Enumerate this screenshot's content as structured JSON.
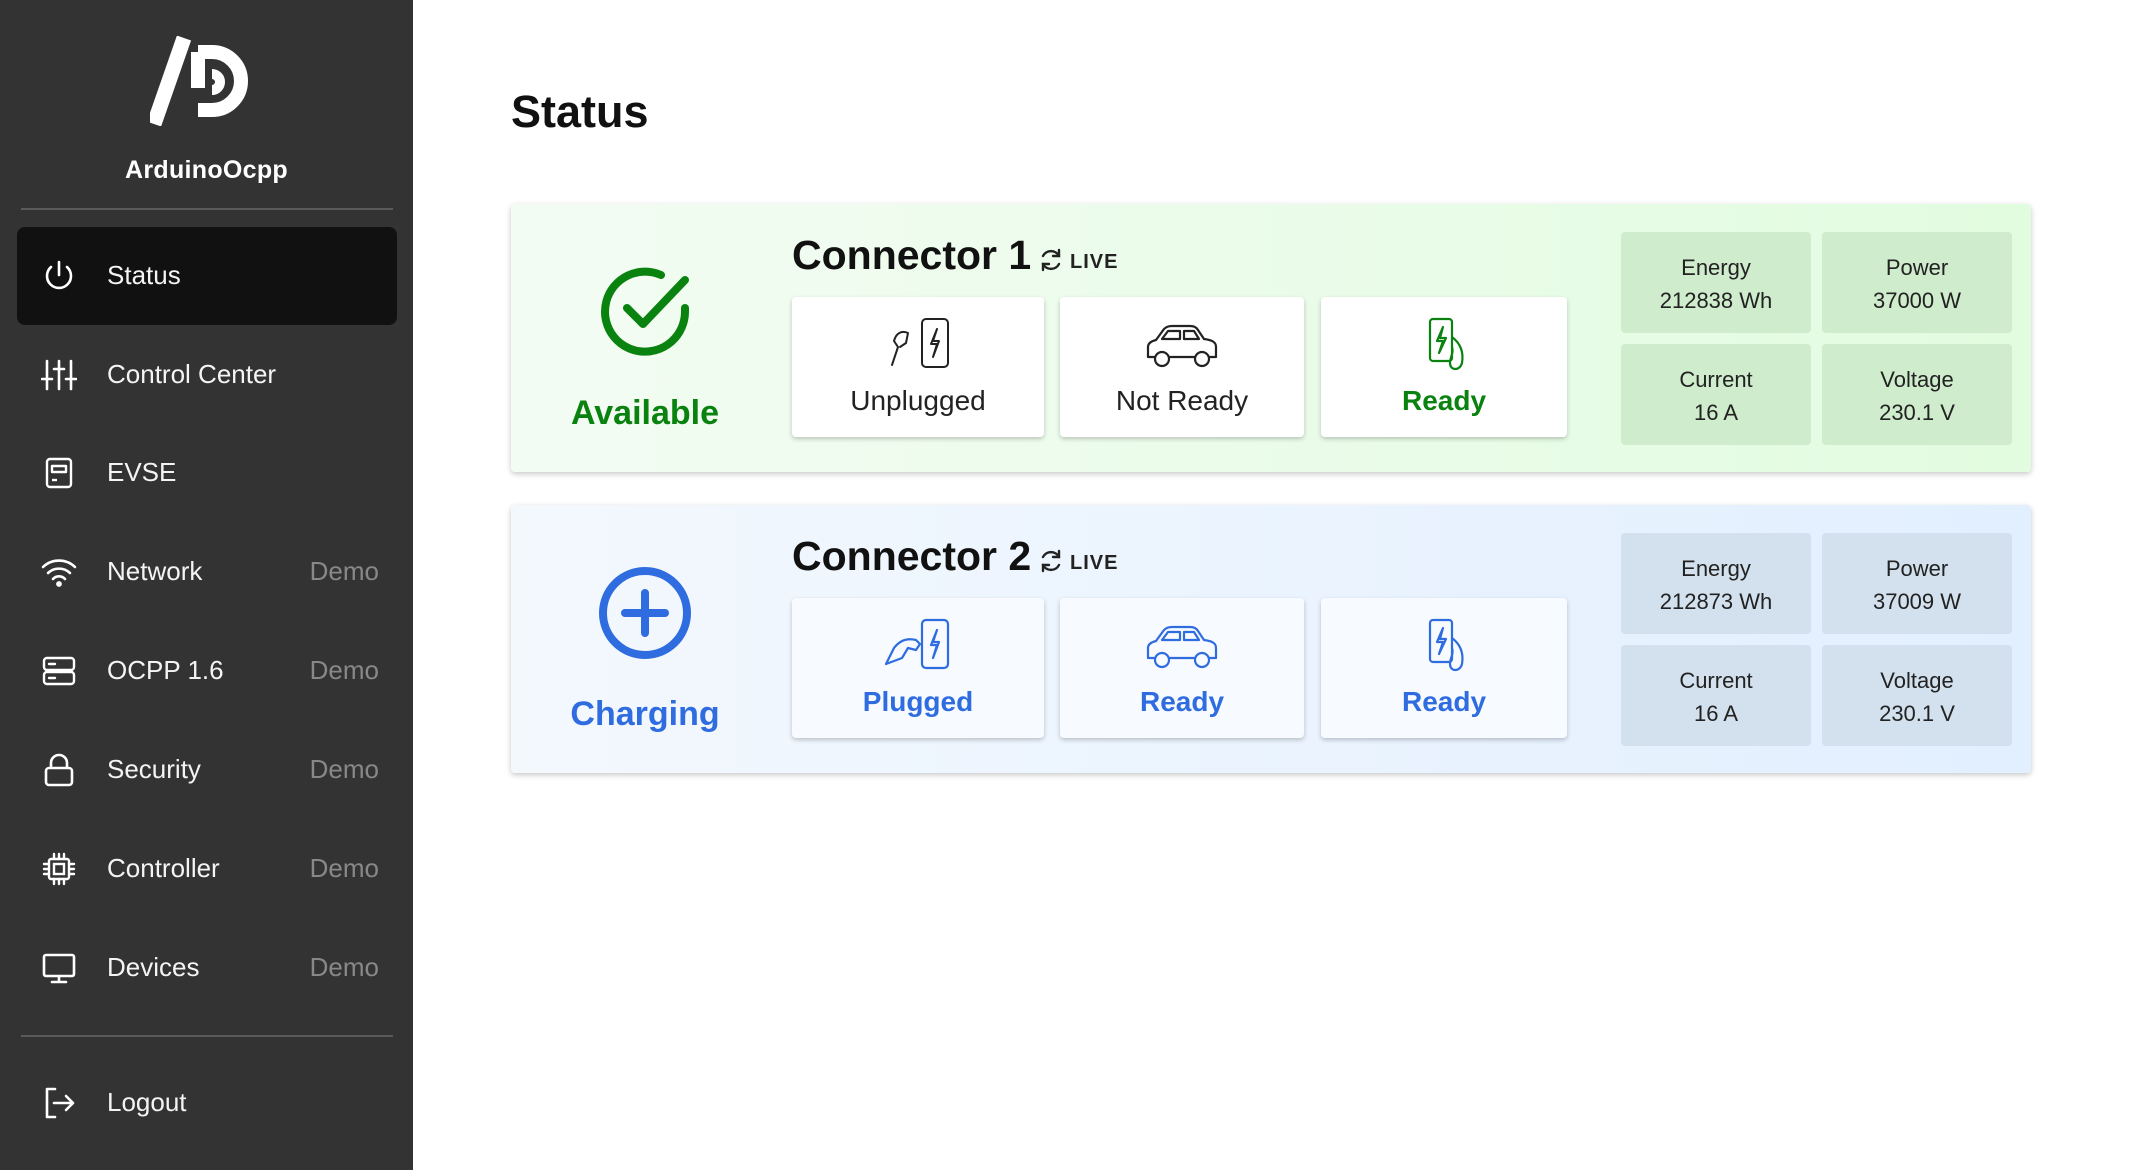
{
  "app": {
    "brand": "ArduinoOcpp"
  },
  "sidebar": {
    "items": [
      {
        "label": "Status",
        "demo": "",
        "icon": "power-icon"
      },
      {
        "label": "Control Center",
        "demo": "",
        "icon": "sliders-icon"
      },
      {
        "label": "EVSE",
        "demo": "",
        "icon": "evse-icon"
      },
      {
        "label": "Network",
        "demo": "Demo",
        "icon": "wifi-icon"
      },
      {
        "label": "OCPP 1.6",
        "demo": "Demo",
        "icon": "server-icon"
      },
      {
        "label": "Security",
        "demo": "Demo",
        "icon": "lock-icon"
      },
      {
        "label": "Controller",
        "demo": "Demo",
        "icon": "chip-icon"
      },
      {
        "label": "Devices",
        "demo": "Demo",
        "icon": "monitor-icon"
      }
    ],
    "logout": {
      "label": "Logout",
      "icon": "logout-icon"
    }
  },
  "main": {
    "title": "Status",
    "connectors": [
      {
        "title": "Connector 1",
        "live": "LIVE",
        "status": "Available",
        "status_icon": "check-circle-icon",
        "accent": "#0a820f",
        "tiles": [
          {
            "label": "Unplugged",
            "icon": "unplugged-icon"
          },
          {
            "label": "Not Ready",
            "icon": "car-icon"
          },
          {
            "label": "Ready",
            "icon": "charger-icon"
          }
        ],
        "metrics": {
          "energy": {
            "label": "Energy",
            "value": "212838 Wh"
          },
          "power": {
            "label": "Power",
            "value": "37000 W"
          },
          "current": {
            "label": "Current",
            "value": "16 A"
          },
          "voltage": {
            "label": "Voltage",
            "value": "230.1 V"
          }
        }
      },
      {
        "title": "Connector 2",
        "live": "LIVE",
        "status": "Charging",
        "status_icon": "plus-circle-icon",
        "accent": "#2e6ce0",
        "tiles": [
          {
            "label": "Plugged",
            "icon": "plugged-icon"
          },
          {
            "label": "Ready",
            "icon": "car-icon"
          },
          {
            "label": "Ready",
            "icon": "charger-icon"
          }
        ],
        "metrics": {
          "energy": {
            "label": "Energy",
            "value": "212873 Wh"
          },
          "power": {
            "label": "Power",
            "value": "37009 W"
          },
          "current": {
            "label": "Current",
            "value": "16 A"
          },
          "voltage": {
            "label": "Voltage",
            "value": "230.1 V"
          }
        }
      }
    ]
  }
}
